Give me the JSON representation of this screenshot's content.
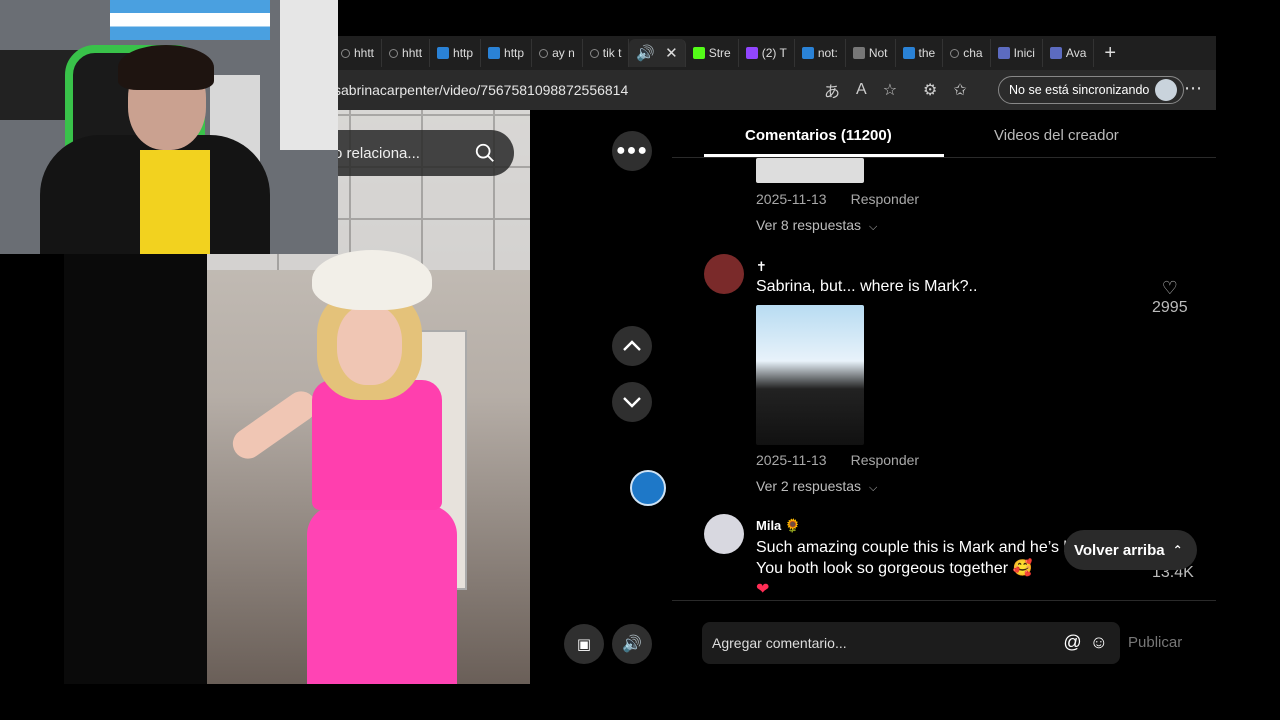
{
  "browser": {
    "tabs": [
      {
        "label": "hhtt",
        "icon": "search-icon"
      },
      {
        "label": "hhtt",
        "icon": "search-icon"
      },
      {
        "label": "http",
        "icon": "bing-icon"
      },
      {
        "label": "http",
        "icon": "bing-icon"
      },
      {
        "label": "ay n",
        "icon": "search-icon"
      },
      {
        "label": "tik t",
        "icon": "search-icon"
      },
      {
        "label": "",
        "icon": "speaker-icon"
      },
      {
        "label": "Stre",
        "icon": "kick-icon"
      },
      {
        "label": "(2) T",
        "icon": "twitch-icon"
      },
      {
        "label": "not:",
        "icon": "bing-icon"
      },
      {
        "label": "Not",
        "icon": "page-icon"
      },
      {
        "label": "the",
        "icon": "bing-icon"
      },
      {
        "label": "cha",
        "icon": "search-icon"
      },
      {
        "label": "Inici",
        "icon": "roblox-icon"
      },
      {
        "label": "Ava",
        "icon": "roblox-icon"
      }
    ],
    "url": "sabrinacarpenter/video/7567581098872556814",
    "sync_label": "No se está sincronizando"
  },
  "video": {
    "search_text": "nido relaciona..."
  },
  "comments": {
    "tab_comments": "Comentarios (11200)",
    "tab_creator": "Videos del creador",
    "items": [
      {
        "date": "2025-11-13",
        "reply": "Responder",
        "view_replies": "Ver 8 respuestas"
      },
      {
        "name": "✝",
        "text": "Sabrina, but... where is Mark?..",
        "likes": "2995",
        "date": "2025-11-13",
        "reply": "Responder",
        "view_replies": "Ver 2 respuestas"
      },
      {
        "name": "Mila 🌻",
        "text": "Such amazing couple this is Mark and he’s boyfriend. You both look so gorgeous together 🥰",
        "emoji": "❤",
        "likes": "13.4K"
      }
    ],
    "back_to_top": "Volver arriba",
    "composer_placeholder": "Agregar comentario...",
    "publish": "Publicar"
  },
  "colors": {
    "accent": "#ffffff",
    "cursor": "#1e78c8",
    "pink": "#ff3fae"
  }
}
